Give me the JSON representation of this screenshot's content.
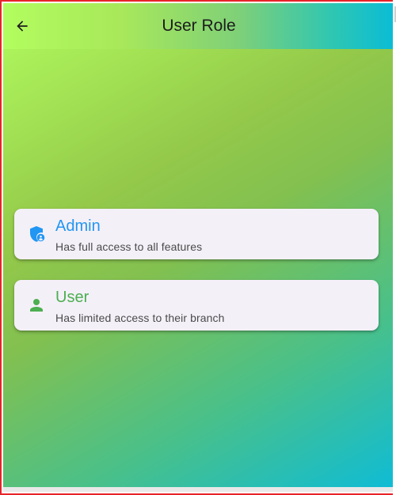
{
  "appbar": {
    "title": "User Role"
  },
  "roles": [
    {
      "title": "Admin",
      "subtitle": "Has full access to all features",
      "icon": "admin-shield-icon",
      "color": "#2196f3"
    },
    {
      "title": "User",
      "subtitle": "Has limited access to their branch",
      "icon": "person-icon",
      "color": "#4caf50"
    }
  ],
  "colors": {
    "gradient_start": "#b2fd5f",
    "gradient_end": "#0ebcd6",
    "card_background": "#f4f0f8",
    "window_border": "#e8232b"
  }
}
